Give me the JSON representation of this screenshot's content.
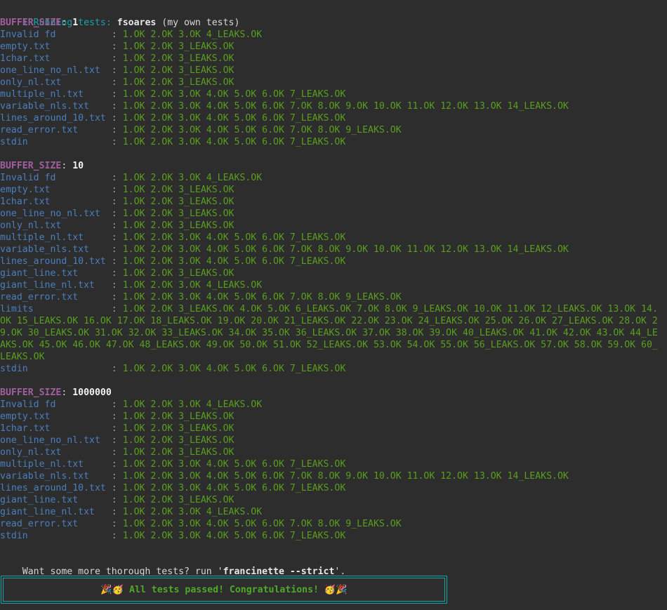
{
  "terminal": {
    "title_line": {
      "icon": "i",
      "prefix": " Running tests: ",
      "tester": "fsoares",
      "suffix": " (my own tests)"
    },
    "colors": {
      "background": "#2d2d2d",
      "teal": "#17a2a8",
      "purple": "#a05fa0",
      "blue": "#4a7fbf",
      "green": "#5a9e1e",
      "white": "#e8e8e8",
      "box_border": "#17a2a8",
      "box_text": "#4fa82a"
    },
    "buffer_label": "BUFFER_SIZE",
    "separator": ":",
    "sections": [
      {
        "buffer_size": "1",
        "rows": [
          {
            "name": "Invalid fd",
            "result": "1.OK 2.OK 3.OK 4_LEAKS.OK"
          },
          {
            "name": "empty.txt",
            "result": "1.OK 2.OK 3_LEAKS.OK"
          },
          {
            "name": "1char.txt",
            "result": "1.OK 2.OK 3_LEAKS.OK"
          },
          {
            "name": "one_line_no_nl.txt",
            "result": "1.OK 2.OK 3_LEAKS.OK"
          },
          {
            "name": "only_nl.txt",
            "result": "1.OK 2.OK 3_LEAKS.OK"
          },
          {
            "name": "multiple_nl.txt",
            "result": "1.OK 2.OK 3.OK 4.OK 5.OK 6.OK 7_LEAKS.OK"
          },
          {
            "name": "variable_nls.txt",
            "result": "1.OK 2.OK 3.OK 4.OK 5.OK 6.OK 7.OK 8.OK 9.OK 10.OK 11.OK 12.OK 13.OK 14_LEAKS.OK"
          },
          {
            "name": "lines_around_10.txt",
            "result": "1.OK 2.OK 3.OK 4.OK 5.OK 6.OK 7_LEAKS.OK"
          },
          {
            "name": "read_error.txt",
            "result": "1.OK 2.OK 3.OK 4.OK 5.OK 6.OK 7.OK 8.OK 9_LEAKS.OK"
          },
          {
            "name": "stdin",
            "result": "1.OK 2.OK 3.OK 4.OK 5.OK 6.OK 7_LEAKS.OK"
          }
        ]
      },
      {
        "buffer_size": "10",
        "rows": [
          {
            "name": "Invalid fd",
            "result": "1.OK 2.OK 3.OK 4_LEAKS.OK"
          },
          {
            "name": "empty.txt",
            "result": "1.OK 2.OK 3_LEAKS.OK"
          },
          {
            "name": "1char.txt",
            "result": "1.OK 2.OK 3_LEAKS.OK"
          },
          {
            "name": "one_line_no_nl.txt",
            "result": "1.OK 2.OK 3_LEAKS.OK"
          },
          {
            "name": "only_nl.txt",
            "result": "1.OK 2.OK 3_LEAKS.OK"
          },
          {
            "name": "multiple_nl.txt",
            "result": "1.OK 2.OK 3.OK 4.OK 5.OK 6.OK 7_LEAKS.OK"
          },
          {
            "name": "variable_nls.txt",
            "result": "1.OK 2.OK 3.OK 4.OK 5.OK 6.OK 7.OK 8.OK 9.OK 10.OK 11.OK 12.OK 13.OK 14_LEAKS.OK"
          },
          {
            "name": "lines_around_10.txt",
            "result": "1.OK 2.OK 3.OK 4.OK 5.OK 6.OK 7_LEAKS.OK"
          },
          {
            "name": "giant_line.txt",
            "result": "1.OK 2.OK 3_LEAKS.OK"
          },
          {
            "name": "giant_line_nl.txt",
            "result": "1.OK 2.OK 3.OK 4_LEAKS.OK"
          },
          {
            "name": "read_error.txt",
            "result": "1.OK 2.OK 3.OK 4.OK 5.OK 6.OK 7.OK 8.OK 9_LEAKS.OK"
          },
          {
            "name": "limits",
            "result": "1.OK 2.OK 3_LEAKS.OK 4.OK 5.OK 6_LEAKS.OK 7.OK 8.OK 9_LEAKS.OK 10.OK 11.OK 12_LEAKS.OK 13.OK 14.",
            "wrapped": [
              "OK 15_LEAKS.OK 16.OK 17.OK 18_LEAKS.OK 19.OK 20.OK 21_LEAKS.OK 22.OK 23.OK 24_LEAKS.OK 25.OK 26.OK 27_LEAKS.OK 28.OK 2",
              "9.OK 30_LEAKS.OK 31.OK 32.OK 33_LEAKS.OK 34.OK 35.OK 36_LEAKS.OK 37.OK 38.OK 39.OK 40_LEAKS.OK 41.OK 42.OK 43.OK 44_LE",
              "AKS.OK 45.OK 46.OK 47.OK 48_LEAKS.OK 49.OK 50.OK 51.OK 52_LEAKS.OK 53.OK 54.OK 55.OK 56_LEAKS.OK 57.OK 58.OK 59.OK 60_",
              "LEAKS.OK"
            ]
          },
          {
            "name": "stdin",
            "result": "1.OK 2.OK 3.OK 4.OK 5.OK 6.OK 7_LEAKS.OK"
          }
        ]
      },
      {
        "buffer_size": "1000000",
        "rows": [
          {
            "name": "Invalid fd",
            "result": "1.OK 2.OK 3.OK 4_LEAKS.OK"
          },
          {
            "name": "empty.txt",
            "result": "1.OK 2.OK 3_LEAKS.OK"
          },
          {
            "name": "1char.txt",
            "result": "1.OK 2.OK 3_LEAKS.OK"
          },
          {
            "name": "one_line_no_nl.txt",
            "result": "1.OK 2.OK 3_LEAKS.OK"
          },
          {
            "name": "only_nl.txt",
            "result": "1.OK 2.OK 3_LEAKS.OK"
          },
          {
            "name": "multiple_nl.txt",
            "result": "1.OK 2.OK 3.OK 4.OK 5.OK 6.OK 7_LEAKS.OK"
          },
          {
            "name": "variable_nls.txt",
            "result": "1.OK 2.OK 3.OK 4.OK 5.OK 6.OK 7.OK 8.OK 9.OK 10.OK 11.OK 12.OK 13.OK 14_LEAKS.OK"
          },
          {
            "name": "lines_around_10.txt",
            "result": "1.OK 2.OK 3.OK 4.OK 5.OK 6.OK 7_LEAKS.OK"
          },
          {
            "name": "giant_line.txt",
            "result": "1.OK 2.OK 3_LEAKS.OK"
          },
          {
            "name": "giant_line_nl.txt",
            "result": "1.OK 2.OK 3.OK 4_LEAKS.OK"
          },
          {
            "name": "read_error.txt",
            "result": "1.OK 2.OK 3.OK 4.OK 5.OK 6.OK 7.OK 8.OK 9_LEAKS.OK"
          },
          {
            "name": "stdin",
            "result": "1.OK 2.OK 3.OK 4.OK 5.OK 6.OK 7_LEAKS.OK"
          }
        ]
      }
    ],
    "footer": {
      "prompt_prefix": "Want some more thorough tests? run '",
      "command": "francinette --strict",
      "prompt_suffix": "'."
    },
    "success_box": {
      "emoji_left": "🎉🥳",
      "message": "All tests passed! Congratulations!",
      "emoji_right": "🥳🎉"
    }
  }
}
